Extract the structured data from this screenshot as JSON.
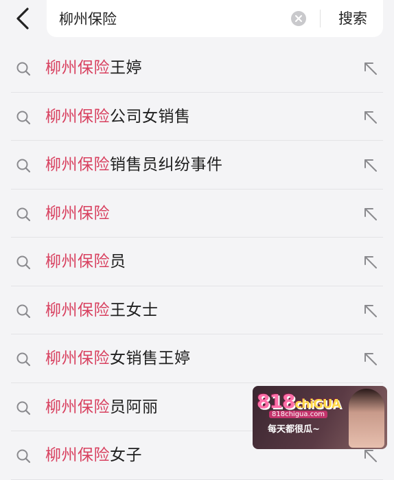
{
  "header": {
    "back_icon": "chevron-left-icon",
    "query": "柳州保险",
    "clear_icon": "clear-circle-icon",
    "search_label": "搜索"
  },
  "suggestions": [
    {
      "highlight": "柳州保险",
      "rest": "王婷"
    },
    {
      "highlight": "柳州保险",
      "rest": "公司女销售"
    },
    {
      "highlight": "柳州保险",
      "rest": "销售员纠纷事件"
    },
    {
      "highlight": "柳州保险",
      "rest": ""
    },
    {
      "highlight": "柳州保险",
      "rest": "员"
    },
    {
      "highlight": "柳州保险",
      "rest": "王女士"
    },
    {
      "highlight": "柳州保险",
      "rest": "女销售王婷"
    },
    {
      "highlight": "柳州保险",
      "rest": "员阿丽"
    },
    {
      "highlight": "柳州保险",
      "rest": "女子"
    }
  ],
  "suggestion_icons": {
    "left": "search-icon",
    "right": "fill-query-arrow-icon"
  },
  "ad": {
    "logo_number": "818",
    "logo_word": "chiGUA",
    "url": "818chigua.com",
    "slogan": "每天都很瓜~"
  },
  "colors": {
    "highlight": "#d8405f",
    "background": "#f4f4f6"
  }
}
